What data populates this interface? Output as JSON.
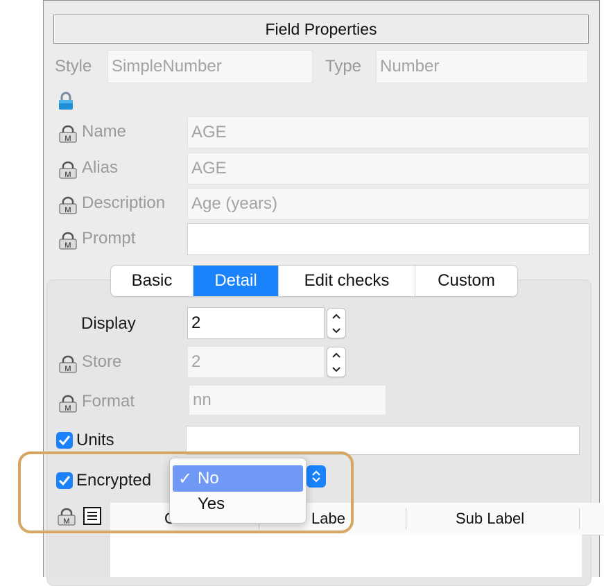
{
  "window": {
    "title": "Field Properties"
  },
  "top": {
    "style_label": "Style",
    "style_value": "SimpleNumber",
    "type_label": "Type",
    "type_value": "Number"
  },
  "fields": {
    "name_label": "Name",
    "name_value": "AGE",
    "alias_label": "Alias",
    "alias_value": "AGE",
    "description_label": "Description",
    "description_value": "Age (years)",
    "prompt_label": "Prompt",
    "prompt_value": ""
  },
  "tabs": [
    {
      "label": "Basic",
      "selected": false
    },
    {
      "label": "Detail",
      "selected": true
    },
    {
      "label": "Edit checks",
      "selected": false
    },
    {
      "label": "Custom",
      "selected": false
    }
  ],
  "detail": {
    "display_label": "Display",
    "display_value": "2",
    "store_label": "Store",
    "store_value": "2",
    "format_label": "Format",
    "format_value": "nn",
    "units_label": "Units",
    "units_checked": true,
    "units_value": "",
    "encrypted_label": "Encrypted",
    "encrypted_checked": true
  },
  "encrypted_menu": {
    "options": [
      "No",
      "Yes"
    ],
    "selected": "No",
    "check_mark": "✓"
  },
  "table": {
    "col1_partial": "C",
    "col2_partial": "Labe",
    "col3": "Sub Label"
  },
  "colors": {
    "accent": "#1a82fb",
    "highlight": "#d6a663",
    "menu_selected": "#6f99f4"
  },
  "icons": [
    "lock-icon",
    "mandatory-lock-icon",
    "checkbox-icon",
    "stepper-icon",
    "popup-chevrons-icon",
    "list-icon"
  ]
}
